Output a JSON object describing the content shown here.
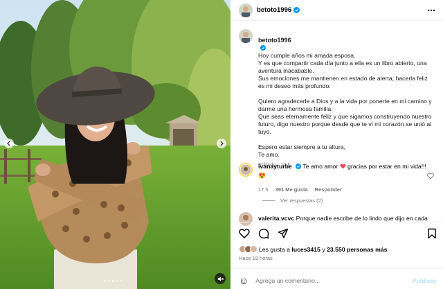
{
  "post": {
    "username": "betoto1996",
    "caption": {
      "line1": "Hoy cumple años mi amada esposa.",
      "para1": "Y es que compartir cada día junto a ella es un libro abierto, una aventura inacabable.\nSus emociones me mantienen en estado de alerta, hacerla feliz es mi deseo más profundo.",
      "para2": "Quiero agradecerle a Dios y a la vida por ponerte en mi camino y darme una hermosa familia.\nQue seas eternamente feliz y que sigamos construyendo nuestro futuro, digo nuestro porque desde que te vi mi corazón se unió al tuyo.",
      "para3": "Espero estar siempre a tu altura,\nTe amo."
    },
    "caption_meta": "Editado · 10 h"
  },
  "comments": [
    {
      "username": "ivanayturbe",
      "text_before": "Te amo amor",
      "text_after": "gracias por estar en mi vida!!!",
      "emoji": "😍",
      "time": "17 h",
      "likes": "391 Me gusta",
      "reply": "Responder"
    },
    {
      "username": "valerita.vcvc",
      "text": "Porque nadie escribe de lo lindo que dijo en cada"
    }
  ],
  "replies_label": "Ver respuestas (2)",
  "likes": {
    "prefix": "Les gusta a",
    "user": "luces3415",
    "connector": "y",
    "count": "23.550 personas más"
  },
  "timestamp": "Hace 19 horas",
  "comment_input": {
    "placeholder": "Agrega un comentario...",
    "emoji": "☺"
  },
  "publish_label": "Publicar",
  "colors": {
    "verified": "#0095f6",
    "heart": "#ed4956",
    "link": "#0095f6"
  },
  "carousel": {
    "slides": 5,
    "active": 3
  }
}
